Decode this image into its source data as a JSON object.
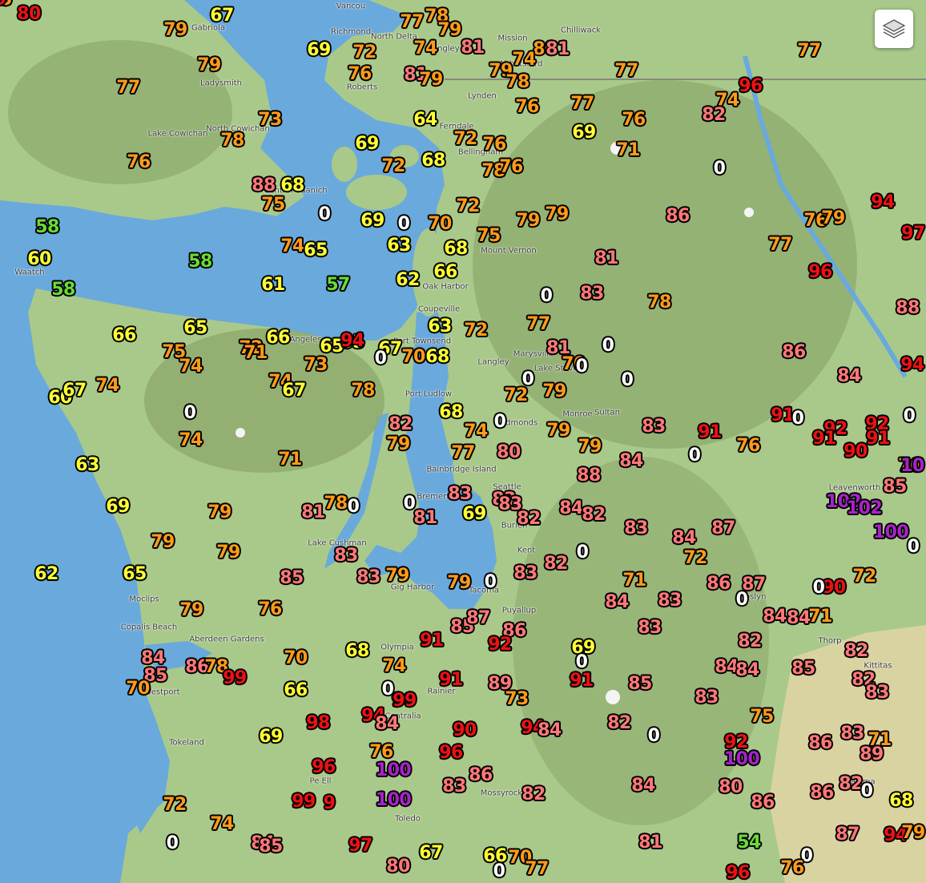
{
  "map": {
    "kind": "terrain",
    "region": "Western Washington / Vancouver Island"
  },
  "colors": {
    "water": "#6aa9dc",
    "land": "#a9c98a",
    "mountain": "#8daa6c",
    "arid": "#d9d3a2",
    "green": "#66dd33",
    "yellow": "#ffff33",
    "orange": "#ff9a1a",
    "salmon": "#ff7777",
    "red": "#ee1111",
    "purple": "#aa22cc",
    "white": "#ffffff"
  },
  "icons": {
    "layers_button": "layers-icon"
  },
  "places": [
    {
      "label": "Vancou"
    },
    {
      "label": "Richmond"
    },
    {
      "label": "North Delta"
    },
    {
      "label": "Langley"
    },
    {
      "label": "Mission"
    },
    {
      "label": "Chilliwack"
    },
    {
      "label": "Abbotsford"
    },
    {
      "label": "Lynden"
    },
    {
      "label": "Ferndale"
    },
    {
      "label": "Bellingham"
    },
    {
      "label": "Ladysmith"
    },
    {
      "label": "Lake Cowichan"
    },
    {
      "label": "North Cowichan"
    },
    {
      "label": "Central Saanich"
    },
    {
      "label": "Mount Vernon"
    },
    {
      "label": "Oak Harbor"
    },
    {
      "label": "Coupeville"
    },
    {
      "label": "Port Angeles"
    },
    {
      "label": "Port Townsend"
    },
    {
      "label": "Langley"
    },
    {
      "label": "Marysville"
    },
    {
      "label": "Lake Stevens"
    },
    {
      "label": "Port Ludlow"
    },
    {
      "label": "Monroe"
    },
    {
      "label": "Sultan"
    },
    {
      "label": "Edmonds"
    },
    {
      "label": "Bainbridge Island"
    },
    {
      "label": "Seattle"
    },
    {
      "label": "Bremerton"
    },
    {
      "label": "Burien"
    },
    {
      "label": "Kent"
    },
    {
      "label": "Leavenworth"
    },
    {
      "label": "Lake Cushman"
    },
    {
      "label": "Gig Harbor"
    },
    {
      "label": "Tacoma"
    },
    {
      "label": "Puyallup"
    },
    {
      "label": "Roslyn"
    },
    {
      "label": "Moclips"
    },
    {
      "label": "Copalis Beach"
    },
    {
      "label": "Aberdeen Gardens"
    },
    {
      "label": "Olympia"
    },
    {
      "label": "Westport"
    },
    {
      "label": "Rainier"
    },
    {
      "label": "Centralia"
    },
    {
      "label": "Thorp"
    },
    {
      "label": "Kittitas"
    },
    {
      "label": "Tokeland"
    },
    {
      "label": "Pe Ell"
    },
    {
      "label": "Mossyrock"
    },
    {
      "label": "Toledo"
    },
    {
      "label": "Yakima"
    },
    {
      "label": "Waatch"
    },
    {
      "label": "Roberts"
    },
    {
      "label": "Gabriola"
    }
  ],
  "temperatures": [
    {
      "v": "80",
      "c": "red"
    },
    {
      "v": "67",
      "c": "yellow"
    },
    {
      "v": "79",
      "c": "orange"
    },
    {
      "v": "79",
      "c": "orange"
    },
    {
      "v": "77",
      "c": "orange"
    },
    {
      "v": "73",
      "c": "orange"
    },
    {
      "v": "78",
      "c": "orange"
    },
    {
      "v": "76",
      "c": "orange"
    },
    {
      "v": "88",
      "c": "salmon"
    },
    {
      "v": "68",
      "c": "yellow"
    },
    {
      "v": "75",
      "c": "orange"
    },
    {
      "v": "0",
      "c": "white"
    },
    {
      "v": "74",
      "c": "orange"
    },
    {
      "v": "65",
      "c": "yellow"
    },
    {
      "v": "58",
      "c": "green"
    },
    {
      "v": "60",
      "c": "yellow"
    },
    {
      "v": "58",
      "c": "green"
    },
    {
      "v": "58",
      "c": "green"
    },
    {
      "v": "61",
      "c": "yellow"
    },
    {
      "v": "57",
      "c": "green"
    },
    {
      "v": "69",
      "c": "yellow"
    },
    {
      "v": "72",
      "c": "orange"
    },
    {
      "v": "76",
      "c": "orange"
    },
    {
      "v": "77",
      "c": "orange"
    },
    {
      "v": "78",
      "c": "orange"
    },
    {
      "v": "79",
      "c": "orange"
    },
    {
      "v": "74",
      "c": "orange"
    },
    {
      "v": "81",
      "c": "salmon"
    },
    {
      "v": "81",
      "c": "salmon"
    },
    {
      "v": "79",
      "c": "orange"
    },
    {
      "v": "79",
      "c": "orange"
    },
    {
      "v": "78",
      "c": "orange"
    },
    {
      "v": "80",
      "c": "orange"
    },
    {
      "v": "81",
      "c": "salmon"
    },
    {
      "v": "74",
      "c": "orange"
    },
    {
      "v": "77",
      "c": "orange"
    },
    {
      "v": "64",
      "c": "yellow"
    },
    {
      "v": "69",
      "c": "yellow"
    },
    {
      "v": "72",
      "c": "orange"
    },
    {
      "v": "68",
      "c": "yellow"
    },
    {
      "v": "72",
      "c": "orange"
    },
    {
      "v": "76",
      "c": "orange"
    },
    {
      "v": "78",
      "c": "orange"
    },
    {
      "v": "76",
      "c": "orange"
    },
    {
      "v": "76",
      "c": "orange"
    },
    {
      "v": "69",
      "c": "yellow"
    },
    {
      "v": "77",
      "c": "orange"
    },
    {
      "v": "76",
      "c": "orange"
    },
    {
      "v": "71",
      "c": "orange"
    },
    {
      "v": "74",
      "c": "orange"
    },
    {
      "v": "82",
      "c": "salmon"
    },
    {
      "v": "96",
      "c": "red"
    },
    {
      "v": "77",
      "c": "orange"
    },
    {
      "v": "0",
      "c": "white"
    },
    {
      "v": "69",
      "c": "yellow"
    },
    {
      "v": "0",
      "c": "white"
    },
    {
      "v": "70",
      "c": "orange"
    },
    {
      "v": "72",
      "c": "orange"
    },
    {
      "v": "79",
      "c": "orange"
    },
    {
      "v": "79",
      "c": "orange"
    },
    {
      "v": "63",
      "c": "yellow"
    },
    {
      "v": "68",
      "c": "yellow"
    },
    {
      "v": "75",
      "c": "orange"
    },
    {
      "v": "66",
      "c": "yellow"
    },
    {
      "v": "62",
      "c": "yellow"
    },
    {
      "v": "86",
      "c": "salmon"
    },
    {
      "v": "81",
      "c": "salmon"
    },
    {
      "v": "76",
      "c": "orange"
    },
    {
      "v": "79",
      "c": "orange"
    },
    {
      "v": "94",
      "c": "red"
    },
    {
      "v": "77",
      "c": "orange"
    },
    {
      "v": "96",
      "c": "red"
    },
    {
      "v": "0",
      "c": "white"
    },
    {
      "v": "83",
      "c": "salmon"
    },
    {
      "v": "78",
      "c": "orange"
    },
    {
      "v": "88",
      "c": "salmon"
    },
    {
      "v": "66",
      "c": "yellow"
    },
    {
      "v": "65",
      "c": "yellow"
    },
    {
      "v": "75",
      "c": "orange"
    },
    {
      "v": "74",
      "c": "orange"
    },
    {
      "v": "72",
      "c": "orange"
    },
    {
      "v": "71",
      "c": "orange"
    },
    {
      "v": "66",
      "c": "yellow"
    },
    {
      "v": "73",
      "c": "orange"
    },
    {
      "v": "65",
      "c": "yellow"
    },
    {
      "v": "65",
      "c": "yellow"
    },
    {
      "v": "67",
      "c": "yellow"
    },
    {
      "v": "0",
      "c": "white"
    },
    {
      "v": "70",
      "c": "orange"
    },
    {
      "v": "68",
      "c": "yellow"
    },
    {
      "v": "63",
      "c": "yellow"
    },
    {
      "v": "72",
      "c": "orange"
    },
    {
      "v": "77",
      "c": "orange"
    },
    {
      "v": "81",
      "c": "salmon"
    },
    {
      "v": "70",
      "c": "orange"
    },
    {
      "v": "0",
      "c": "white"
    },
    {
      "v": "0",
      "c": "white"
    },
    {
      "v": "86",
      "c": "salmon"
    },
    {
      "v": "84",
      "c": "salmon"
    },
    {
      "v": "94",
      "c": "red"
    },
    {
      "v": "60",
      "c": "yellow"
    },
    {
      "v": "67",
      "c": "yellow"
    },
    {
      "v": "74",
      "c": "orange"
    },
    {
      "v": "74",
      "c": "orange"
    },
    {
      "v": "67",
      "c": "yellow"
    },
    {
      "v": "78",
      "c": "orange"
    },
    {
      "v": "0",
      "c": "white"
    },
    {
      "v": "72",
      "c": "orange"
    },
    {
      "v": "79",
      "c": "orange"
    },
    {
      "v": "0",
      "c": "white"
    },
    {
      "v": "0",
      "c": "white"
    },
    {
      "v": "68",
      "c": "yellow"
    },
    {
      "v": "82",
      "c": "salmon"
    },
    {
      "v": "74",
      "c": "orange"
    },
    {
      "v": "0",
      "c": "white"
    },
    {
      "v": "79",
      "c": "orange"
    },
    {
      "v": "79",
      "c": "orange"
    },
    {
      "v": "83",
      "c": "salmon"
    },
    {
      "v": "91",
      "c": "red"
    },
    {
      "v": "91",
      "c": "red"
    },
    {
      "v": "0",
      "c": "white"
    },
    {
      "v": "92",
      "c": "red"
    },
    {
      "v": "91",
      "c": "red"
    },
    {
      "v": "92",
      "c": "red"
    },
    {
      "v": "91",
      "c": "red"
    },
    {
      "v": "90",
      "c": "red"
    },
    {
      "v": "0",
      "c": "white"
    },
    {
      "v": "74",
      "c": "orange"
    },
    {
      "v": "71",
      "c": "orange"
    },
    {
      "v": "79",
      "c": "orange"
    },
    {
      "v": "77",
      "c": "orange"
    },
    {
      "v": "80",
      "c": "salmon"
    },
    {
      "v": "84",
      "c": "salmon"
    },
    {
      "v": "76",
      "c": "orange"
    },
    {
      "v": "0",
      "c": "white"
    },
    {
      "v": "76",
      "c": "orange"
    },
    {
      "v": "63",
      "c": "yellow"
    },
    {
      "v": "88",
      "c": "salmon"
    },
    {
      "v": "10",
      "c": "purple"
    },
    {
      "v": "85",
      "c": "salmon"
    },
    {
      "v": "69",
      "c": "yellow"
    },
    {
      "v": "79",
      "c": "orange"
    },
    {
      "v": "81",
      "c": "salmon"
    },
    {
      "v": "78",
      "c": "orange"
    },
    {
      "v": "0",
      "c": "white"
    },
    {
      "v": "0",
      "c": "white"
    },
    {
      "v": "81",
      "c": "salmon"
    },
    {
      "v": "83",
      "c": "salmon"
    },
    {
      "v": "69",
      "c": "yellow"
    },
    {
      "v": "83",
      "c": "salmon"
    },
    {
      "v": "83",
      "c": "salmon"
    },
    {
      "v": "82",
      "c": "salmon"
    },
    {
      "v": "84",
      "c": "salmon"
    },
    {
      "v": "82",
      "c": "salmon"
    },
    {
      "v": "102",
      "c": "purple"
    },
    {
      "v": "102",
      "c": "purple"
    },
    {
      "v": "72",
      "c": "orange"
    },
    {
      "v": "79",
      "c": "orange"
    },
    {
      "v": "83",
      "c": "salmon"
    },
    {
      "v": "84",
      "c": "salmon"
    },
    {
      "v": "87",
      "c": "salmon"
    },
    {
      "v": "100",
      "c": "purple"
    },
    {
      "v": "62",
      "c": "yellow"
    },
    {
      "v": "65",
      "c": "yellow"
    },
    {
      "v": "79",
      "c": "orange"
    },
    {
      "v": "83",
      "c": "salmon"
    },
    {
      "v": "0",
      "c": "white"
    },
    {
      "v": "82",
      "c": "salmon"
    },
    {
      "v": "72",
      "c": "orange"
    },
    {
      "v": "90",
      "c": "red"
    },
    {
      "v": "85",
      "c": "salmon"
    },
    {
      "v": "83",
      "c": "salmon"
    },
    {
      "v": "79",
      "c": "orange"
    },
    {
      "v": "79",
      "c": "orange"
    },
    {
      "v": "0",
      "c": "white"
    },
    {
      "v": "83",
      "c": "salmon"
    },
    {
      "v": "71",
      "c": "orange"
    },
    {
      "v": "86",
      "c": "salmon"
    },
    {
      "v": "87",
      "c": "salmon"
    },
    {
      "v": "0",
      "c": "white"
    },
    {
      "v": "0",
      "c": "white"
    },
    {
      "v": "79",
      "c": "orange"
    },
    {
      "v": "76",
      "c": "orange"
    },
    {
      "v": "84",
      "c": "salmon"
    },
    {
      "v": "83",
      "c": "salmon"
    },
    {
      "v": "0",
      "c": "white"
    },
    {
      "v": "84",
      "c": "salmon"
    },
    {
      "v": "84",
      "c": "salmon"
    },
    {
      "v": "71",
      "c": "orange"
    },
    {
      "v": "85",
      "c": "salmon"
    },
    {
      "v": "87",
      "c": "salmon"
    },
    {
      "v": "86",
      "c": "salmon"
    },
    {
      "v": "91",
      "c": "red"
    },
    {
      "v": "92",
      "c": "red"
    },
    {
      "v": "83",
      "c": "salmon"
    },
    {
      "v": "82",
      "c": "salmon"
    },
    {
      "v": "82",
      "c": "salmon"
    },
    {
      "v": "84",
      "c": "salmon"
    },
    {
      "v": "85",
      "c": "salmon"
    },
    {
      "v": "86",
      "c": "salmon"
    },
    {
      "v": "78",
      "c": "orange"
    },
    {
      "v": "99",
      "c": "red"
    },
    {
      "v": "70",
      "c": "orange"
    },
    {
      "v": "70",
      "c": "orange"
    },
    {
      "v": "68",
      "c": "yellow"
    },
    {
      "v": "74",
      "c": "orange"
    },
    {
      "v": "69",
      "c": "yellow"
    },
    {
      "v": "0",
      "c": "white"
    },
    {
      "v": "84",
      "c": "salmon"
    },
    {
      "v": "84",
      "c": "salmon"
    },
    {
      "v": "85",
      "c": "salmon"
    },
    {
      "v": "66",
      "c": "yellow"
    },
    {
      "v": "0",
      "c": "white"
    },
    {
      "v": "90",
      "c": "red"
    },
    {
      "v": "91",
      "c": "red"
    },
    {
      "v": "89",
      "c": "salmon"
    },
    {
      "v": "73",
      "c": "orange"
    },
    {
      "v": "91",
      "c": "red"
    },
    {
      "v": "85",
      "c": "salmon"
    },
    {
      "v": "82",
      "c": "salmon"
    },
    {
      "v": "83",
      "c": "salmon"
    },
    {
      "v": "83",
      "c": "salmon"
    },
    {
      "v": "75",
      "c": "orange"
    },
    {
      "v": "69",
      "c": "yellow"
    },
    {
      "v": "98",
      "c": "red"
    },
    {
      "v": "94",
      "c": "red"
    },
    {
      "v": "84",
      "c": "salmon"
    },
    {
      "v": "90",
      "c": "red"
    },
    {
      "v": "94",
      "c": "red"
    },
    {
      "v": "84",
      "c": "salmon"
    },
    {
      "v": "82",
      "c": "salmon"
    },
    {
      "v": "0",
      "c": "white"
    },
    {
      "v": "92",
      "c": "red"
    },
    {
      "v": "86",
      "c": "salmon"
    },
    {
      "v": "83",
      "c": "salmon"
    },
    {
      "v": "71",
      "c": "orange"
    },
    {
      "v": "89",
      "c": "salmon"
    },
    {
      "v": "76",
      "c": "orange"
    },
    {
      "v": "96",
      "c": "red"
    },
    {
      "v": "100",
      "c": "purple"
    },
    {
      "v": "96",
      "c": "red"
    },
    {
      "v": "100",
      "c": "purple"
    },
    {
      "v": "86",
      "c": "salmon"
    },
    {
      "v": "83",
      "c": "salmon"
    },
    {
      "v": "84",
      "c": "salmon"
    },
    {
      "v": "80",
      "c": "salmon"
    },
    {
      "v": "86",
      "c": "salmon"
    },
    {
      "v": "82",
      "c": "salmon"
    },
    {
      "v": "0",
      "c": "white"
    },
    {
      "v": "86",
      "c": "salmon"
    },
    {
      "v": "72",
      "c": "orange"
    },
    {
      "v": "99",
      "c": "red"
    },
    {
      "v": "9",
      "c": "red"
    },
    {
      "v": "100",
      "c": "purple"
    },
    {
      "v": "82",
      "c": "salmon"
    },
    {
      "v": "68",
      "c": "yellow"
    },
    {
      "v": "74",
      "c": "orange"
    },
    {
      "v": "0",
      "c": "white"
    },
    {
      "v": "84",
      "c": "salmon"
    },
    {
      "v": "85",
      "c": "salmon"
    },
    {
      "v": "97",
      "c": "red"
    },
    {
      "v": "67",
      "c": "yellow"
    },
    {
      "v": "66",
      "c": "yellow"
    },
    {
      "v": "70",
      "c": "orange"
    },
    {
      "v": "0",
      "c": "white"
    },
    {
      "v": "77",
      "c": "orange"
    },
    {
      "v": "80",
      "c": "salmon"
    },
    {
      "v": "81",
      "c": "salmon"
    },
    {
      "v": "54",
      "c": "green"
    },
    {
      "v": "0",
      "c": "white"
    },
    {
      "v": "76",
      "c": "orange"
    },
    {
      "v": "87",
      "c": "salmon"
    },
    {
      "v": "94",
      "c": "red"
    },
    {
      "v": "79",
      "c": "orange"
    },
    {
      "v": "96",
      "c": "red"
    },
    {
      "v": "94",
      "c": "red"
    },
    {
      "v": "99",
      "c": "red"
    },
    {
      "v": "97",
      "c": "red"
    },
    {
      "v": "9",
      "c": "red"
    },
    {
      "v": "80",
      "c": "salmon"
    },
    {
      "v": "65",
      "c": "yellow"
    },
    {
      "v": "85",
      "c": "orange"
    },
    {
      "v": "9",
      "c": "red"
    }
  ]
}
